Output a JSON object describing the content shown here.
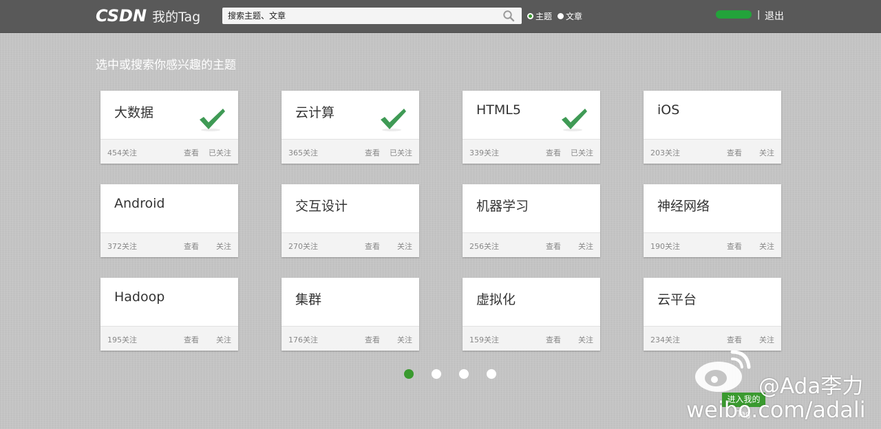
{
  "header": {
    "logo_text": "CSDN",
    "subtitle": "我的Tag",
    "search": {
      "placeholder": "搜索主题、文章",
      "value": ""
    },
    "radios": [
      {
        "label": "主题",
        "selected": true
      },
      {
        "label": "文章",
        "selected": false
      }
    ],
    "separator": "|",
    "logout_label": "退出"
  },
  "main": {
    "section_title": "选中或搜索你感兴趣的主题",
    "view_label": "查看",
    "cards": [
      {
        "title": "大数据",
        "count": "454关注",
        "follow": "已关注",
        "followed": true
      },
      {
        "title": "云计算",
        "count": "365关注",
        "follow": "已关注",
        "followed": true
      },
      {
        "title": "HTML5",
        "count": "339关注",
        "follow": "已关注",
        "followed": true
      },
      {
        "title": "iOS",
        "count": "203关注",
        "follow": "关注",
        "followed": false
      },
      {
        "title": "Android",
        "count": "372关注",
        "follow": "关注",
        "followed": false
      },
      {
        "title": "交互设计",
        "count": "270关注",
        "follow": "关注",
        "followed": false
      },
      {
        "title": "机器学习",
        "count": "256关注",
        "follow": "关注",
        "followed": false
      },
      {
        "title": "神经网络",
        "count": "190关注",
        "follow": "关注",
        "followed": false
      },
      {
        "title": "Hadoop",
        "count": "195关注",
        "follow": "关注",
        "followed": false
      },
      {
        "title": "集群",
        "count": "176关注",
        "follow": "关注",
        "followed": false
      },
      {
        "title": "虚拟化",
        "count": "159关注",
        "follow": "关注",
        "followed": false
      },
      {
        "title": "云平台",
        "count": "234关注",
        "follow": "关注",
        "followed": false
      }
    ],
    "pager": {
      "pages": 4,
      "current": 1
    },
    "enter_button": "进入我的Tag"
  },
  "watermark": {
    "handle": "@Ada李力",
    "url": "weibo.com/adali"
  },
  "colors": {
    "accent": "#3a9a2f",
    "check": "#3f9a55",
    "topbar": "#595959",
    "background": "#c4c4c4"
  },
  "icons": {
    "search": "search-icon",
    "check": "check-icon",
    "weibo": "weibo-logo-icon"
  }
}
